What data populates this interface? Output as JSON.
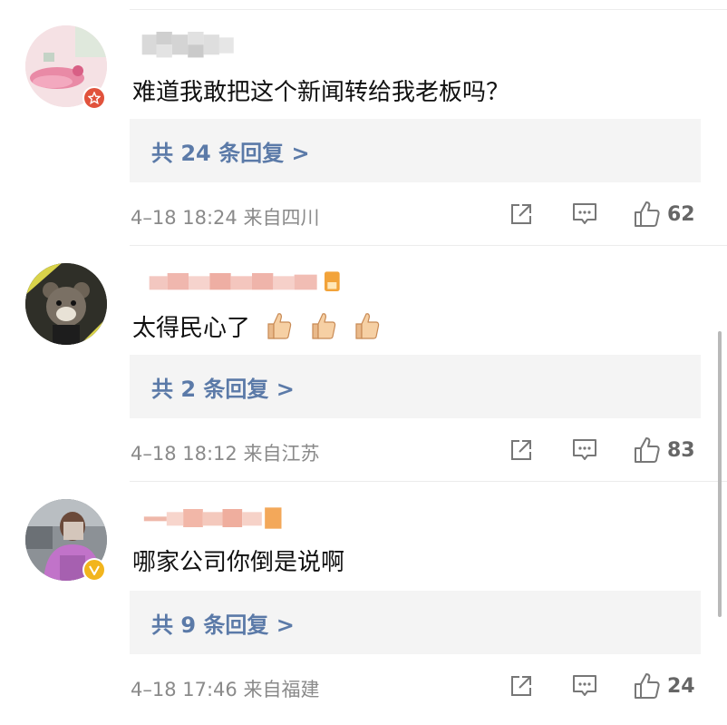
{
  "comments": [
    {
      "text": "难道我敢把这个新闻转给我老板吗？",
      "replies_label": "共 24 条回复 >",
      "time_location": "4–18 18:24  来自四川",
      "likes": "62"
    },
    {
      "text": "太得民心了",
      "replies_label": "共 2 条回复 >",
      "time_location": "4–18 18:12  来自江苏",
      "likes": "83"
    },
    {
      "text": "哪家公司你倒是说啊",
      "replies_label": "共 9 条回复 >",
      "time_location": "4–18 17:46  来自福建",
      "likes": "24"
    }
  ]
}
